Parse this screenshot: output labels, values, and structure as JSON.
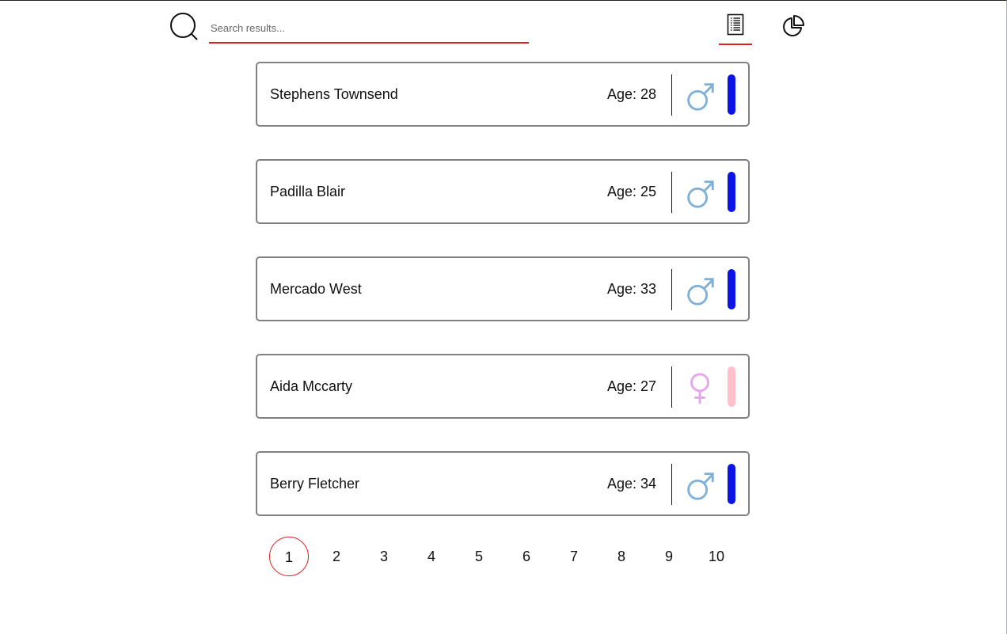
{
  "search": {
    "placeholder": "Search results...",
    "value": ""
  },
  "nav": {
    "active_view": "list",
    "list_icon": "list-document-icon",
    "chart_icon": "pie-chart-icon"
  },
  "colors": {
    "accent": "#e02020",
    "male_icon": "#7fb0d8",
    "male_bar": "#0a14e6",
    "female_icon": "#e6a6ee",
    "female_bar": "#ffc0cb",
    "card_border": "#808080"
  },
  "people": [
    {
      "name": "Stephens Townsend",
      "age_text": "Age: 28",
      "gender": "male"
    },
    {
      "name": "Padilla Blair",
      "age_text": "Age: 25",
      "gender": "male"
    },
    {
      "name": "Mercado West",
      "age_text": "Age: 33",
      "gender": "male"
    },
    {
      "name": "Aida Mccarty",
      "age_text": "Age: 27",
      "gender": "female"
    },
    {
      "name": "Berry Fletcher",
      "age_text": "Age: 34",
      "gender": "male"
    }
  ],
  "pagination": {
    "current": "1",
    "pages": [
      "1",
      "2",
      "3",
      "4",
      "5",
      "6",
      "7",
      "8",
      "9",
      "10"
    ]
  }
}
